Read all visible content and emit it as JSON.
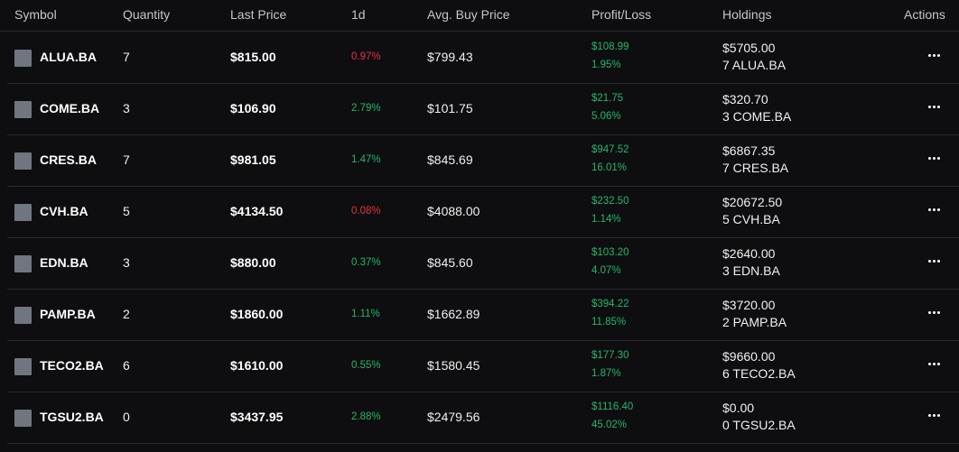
{
  "colors": {
    "background": "#0e0d10",
    "positive": "#22b86a",
    "negative": "#e0353d",
    "icon": "#707680"
  },
  "headers": {
    "symbol": "Symbol",
    "quantity": "Quantity",
    "last_price": "Last Price",
    "day": "1d",
    "avg_buy": "Avg. Buy Price",
    "pl": "Profit/Loss",
    "holdings": "Holdings",
    "actions": "Actions"
  },
  "rows": [
    {
      "symbol": "ALUA.BA",
      "quantity": "7",
      "last_price": "$815.00",
      "change_1d": "0.97%",
      "change_dir": "neg",
      "avg_buy": "$799.43",
      "pl_value": "$108.99",
      "pl_percent": "1.95%",
      "holdings_value": "$5705.00",
      "holdings_units": "7 ALUA.BA",
      "action_icon": "more-horizontal-icon"
    },
    {
      "symbol": "COME.BA",
      "quantity": "3",
      "last_price": "$106.90",
      "change_1d": "2.79%",
      "change_dir": "pos",
      "avg_buy": "$101.75",
      "pl_value": "$21.75",
      "pl_percent": "5.06%",
      "holdings_value": "$320.70",
      "holdings_units": "3 COME.BA",
      "action_icon": "more-horizontal-icon"
    },
    {
      "symbol": "CRES.BA",
      "quantity": "7",
      "last_price": "$981.05",
      "change_1d": "1.47%",
      "change_dir": "pos",
      "avg_buy": "$845.69",
      "pl_value": "$947.52",
      "pl_percent": "16.01%",
      "holdings_value": "$6867.35",
      "holdings_units": "7 CRES.BA",
      "action_icon": "more-horizontal-icon"
    },
    {
      "symbol": "CVH.BA",
      "quantity": "5",
      "last_price": "$4134.50",
      "change_1d": "0.08%",
      "change_dir": "neg",
      "avg_buy": "$4088.00",
      "pl_value": "$232.50",
      "pl_percent": "1.14%",
      "holdings_value": "$20672.50",
      "holdings_units": "5 CVH.BA",
      "action_icon": "more-horizontal-icon"
    },
    {
      "symbol": "EDN.BA",
      "quantity": "3",
      "last_price": "$880.00",
      "change_1d": "0.37%",
      "change_dir": "pos",
      "avg_buy": "$845.60",
      "pl_value": "$103.20",
      "pl_percent": "4.07%",
      "holdings_value": "$2640.00",
      "holdings_units": "3 EDN.BA",
      "action_icon": "more-horizontal-icon"
    },
    {
      "symbol": "PAMP.BA",
      "quantity": "2",
      "last_price": "$1860.00",
      "change_1d": "1.11%",
      "change_dir": "pos",
      "avg_buy": "$1662.89",
      "pl_value": "$394.22",
      "pl_percent": "11.85%",
      "holdings_value": "$3720.00",
      "holdings_units": "2 PAMP.BA",
      "action_icon": "more-horizontal-icon"
    },
    {
      "symbol": "TECO2.BA",
      "quantity": "6",
      "last_price": "$1610.00",
      "change_1d": "0.55%",
      "change_dir": "pos",
      "avg_buy": "$1580.45",
      "pl_value": "$177.30",
      "pl_percent": "1.87%",
      "holdings_value": "$9660.00",
      "holdings_units": "6 TECO2.BA",
      "action_icon": "more-horizontal-icon"
    },
    {
      "symbol": "TGSU2.BA",
      "quantity": "0",
      "last_price": "$3437.95",
      "change_1d": "2.88%",
      "change_dir": "pos",
      "avg_buy": "$2479.56",
      "pl_value": "$1116.40",
      "pl_percent": "45.02%",
      "holdings_value": "$0.00",
      "holdings_units": "0 TGSU2.BA",
      "action_icon": "more-horizontal-icon"
    }
  ]
}
